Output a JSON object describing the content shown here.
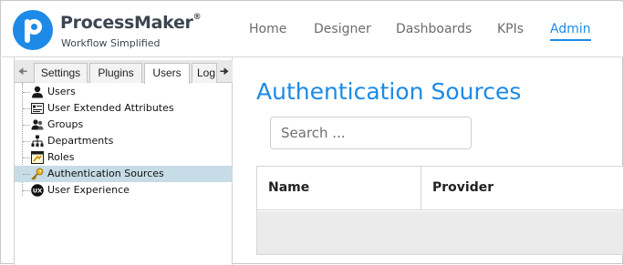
{
  "brand": {
    "name": "ProcessMaker",
    "mark": "®",
    "tagline": "Workflow Simplified"
  },
  "nav": {
    "items": [
      {
        "label": "Home"
      },
      {
        "label": "Designer"
      },
      {
        "label": "Dashboards"
      },
      {
        "label": "KPIs"
      },
      {
        "label": "Admin",
        "active": true
      }
    ]
  },
  "tabs": {
    "items": [
      {
        "label": "Settings"
      },
      {
        "label": "Plugins"
      },
      {
        "label": "Users",
        "active": true
      },
      {
        "label": "Log"
      }
    ]
  },
  "tree": {
    "items": [
      {
        "label": "Users",
        "icon": "user-icon"
      },
      {
        "label": "User Extended Attributes",
        "icon": "attributes-icon"
      },
      {
        "label": "Groups",
        "icon": "group-icon"
      },
      {
        "label": "Departments",
        "icon": "departments-icon"
      },
      {
        "label": "Roles",
        "icon": "roles-icon"
      },
      {
        "label": "Authentication Sources",
        "icon": "key-icon",
        "selected": true
      },
      {
        "label": "User Experience",
        "icon": "ux-icon"
      }
    ]
  },
  "main": {
    "title": "Authentication Sources",
    "search": {
      "placeholder": "Search ...",
      "value": ""
    },
    "table": {
      "columns": [
        "Name",
        "Provider"
      ]
    }
  },
  "colors": {
    "accent": "#1c8ae6",
    "selected_row": "#c6dce6",
    "text_dark": "#3c4652"
  }
}
